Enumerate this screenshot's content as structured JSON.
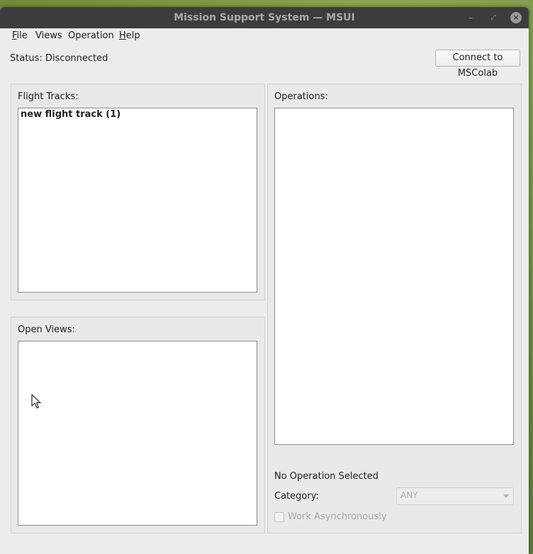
{
  "window": {
    "title": "Mission Support System — MSUI"
  },
  "menu": [
    {
      "label_u": "F",
      "label_rest": "ile"
    },
    {
      "label_u": "",
      "label_rest": "Views"
    },
    {
      "label_u": "",
      "label_rest": "Operation"
    },
    {
      "label_u": "H",
      "label_rest": "elp"
    }
  ],
  "status": {
    "text": "Status: Disconnected"
  },
  "connect_button": {
    "label": "Connect to MSColab"
  },
  "flight_tracks": {
    "label": "Flight Tracks:",
    "items": [
      "new flight track (1)"
    ]
  },
  "open_views": {
    "label": "Open Views:",
    "items": []
  },
  "operations": {
    "label": "Operations:",
    "items": [],
    "selection_text": "No Operation Selected",
    "category_label": "Category:",
    "category_value": "ANY",
    "work_async_label": "Work Asynchronously",
    "work_async_checked": false
  },
  "colors": {
    "titlebar": "#3c3c3c",
    "window_bg": "#ececec",
    "disabled_text": "#a8a8a8"
  }
}
